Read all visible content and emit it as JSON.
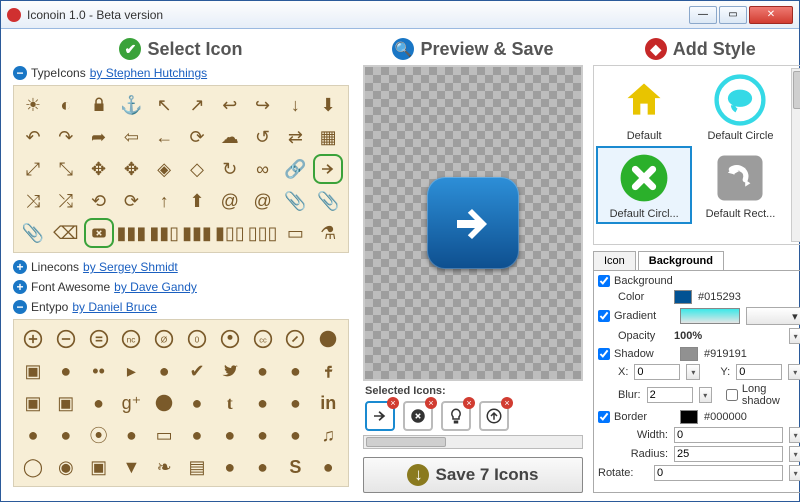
{
  "window": {
    "title": "Iconoin 1.0 - Beta version"
  },
  "headers": {
    "select": "Select Icon",
    "preview": "Preview & Save",
    "style": "Add Style"
  },
  "families": {
    "typeicons": {
      "name": "TypeIcons",
      "author": "by Stephen Hutchings",
      "expanded": true
    },
    "linecons": {
      "name": "Linecons",
      "author": "by Sergey Shmidt",
      "expanded": false
    },
    "fontawesome": {
      "name": "Font Awesome",
      "author": "by Dave Gandy",
      "expanded": false
    },
    "entypo": {
      "name": "Entypo",
      "author": "by Daniel Bruce",
      "expanded": true
    }
  },
  "selected_strip_label": "Selected Icons:",
  "save_button": "Save 7 Icons",
  "styles": [
    {
      "label": "Default"
    },
    {
      "label": "Default Circle"
    },
    {
      "label": "Default Circl..."
    },
    {
      "label": "Default Rect..."
    }
  ],
  "tabs": {
    "icon": "Icon",
    "background": "Background"
  },
  "props": {
    "background_label": "Background",
    "color_label": "Color",
    "color_value": "#015293",
    "gradient_label": "Gradient",
    "opacity_label": "Opacity",
    "opacity_value": "100%",
    "shadow_label": "Shadow",
    "shadow_value": "#919191",
    "x_label": "X:",
    "x_value": "0",
    "y_label": "Y:",
    "y_value": "0",
    "blur_label": "Blur:",
    "blur_value": "2",
    "longshadow_label": "Long shadow",
    "border_label": "Border",
    "border_value": "#000000",
    "width_label": "Width:",
    "width_value": "0",
    "radius_label": "Radius:",
    "radius_value": "25",
    "rotate_label": "Rotate:",
    "rotate_value": "0"
  }
}
